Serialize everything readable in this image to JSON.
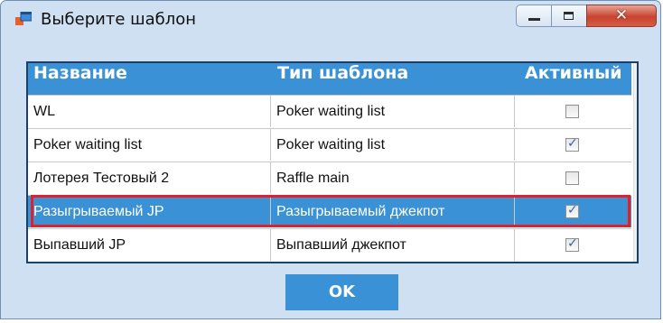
{
  "window": {
    "title": "Выберите шаблон",
    "icons": {
      "app": "app-window-icon",
      "minimize": "minimize-icon",
      "maximize": "maximize-icon",
      "close": "close-icon"
    }
  },
  "grid": {
    "columns": [
      "Название",
      "Тип шаблона",
      "Активный"
    ],
    "rows": [
      {
        "name": "WL",
        "type": "Poker waiting list",
        "active": false
      },
      {
        "name": "Poker waiting list",
        "type": "Poker waiting list",
        "active": true
      },
      {
        "name": "Лотерея Тестовый 2",
        "type": "Raffle main",
        "active": false
      },
      {
        "name": "Разыгрываемый JP",
        "type": "Разыгрываемый джекпот",
        "active": true,
        "selected": true
      },
      {
        "name": "Выпавший JP",
        "type": "Выпавший джекпот",
        "active": true
      }
    ]
  },
  "scrollbar": {
    "up_icon": "scroll-up-icon",
    "down_icon": "scroll-down-icon"
  },
  "buttons": {
    "ok": "OK"
  },
  "colors": {
    "header": "#3a91d5",
    "selection_outline": "#e0202b",
    "window_bg": "#cfe0f2"
  }
}
